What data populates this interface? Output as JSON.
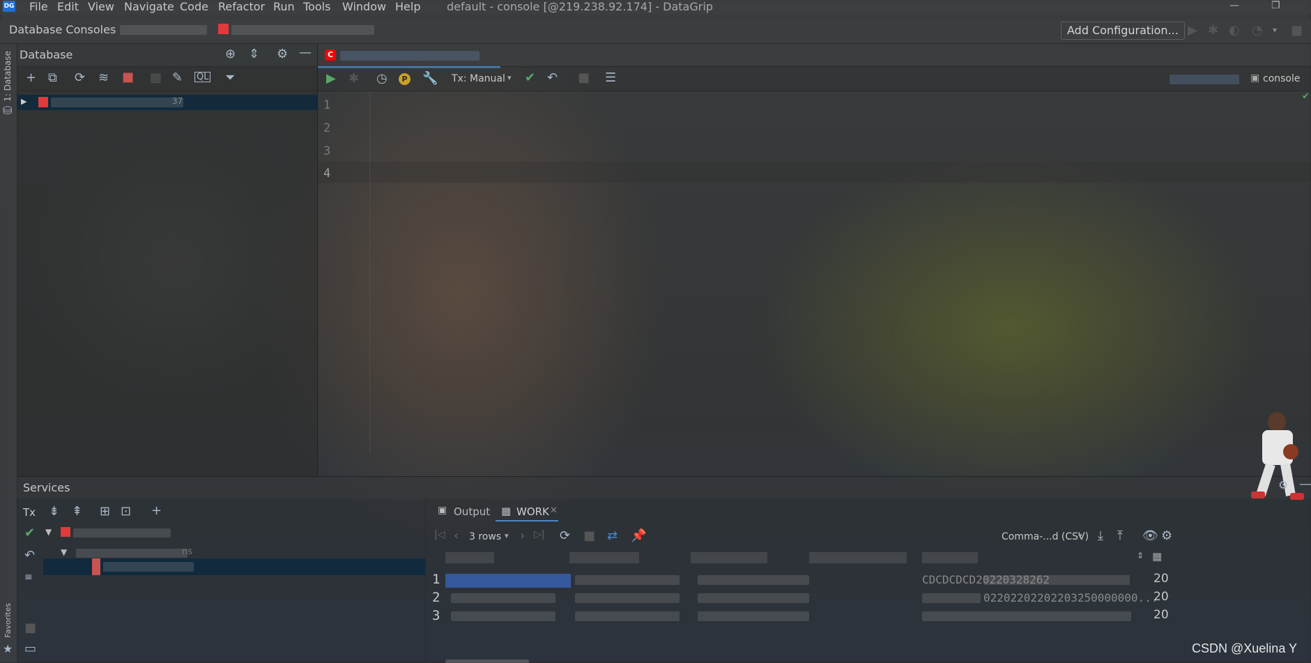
{
  "app": {
    "logo_text": "DG",
    "window_title": "default - console [@219.238.92.174] - DataGrip"
  },
  "menu": [
    "File",
    "Edit",
    "View",
    "Navigate",
    "Code",
    "Refactor",
    "Run",
    "Tools",
    "Window",
    "Help"
  ],
  "navbar": {
    "breadcrumb": "Database Consoles",
    "add_configuration": "Add Configuration..."
  },
  "left_stripe": {
    "database_label": "1: Database",
    "favorites_label": "Favorites"
  },
  "database_panel": {
    "title": "Database",
    "tree_row_suffix": "37"
  },
  "editor": {
    "tx_mode": "Tx: Manual",
    "console_label": "console",
    "line_numbers": [
      "1",
      "2",
      "3",
      "4"
    ]
  },
  "services": {
    "title": "Services",
    "tx_label": "Tx",
    "tree_child_suffix": "ns",
    "tabs": {
      "output": "Output",
      "work": "WORK"
    },
    "result": {
      "rows_label": "3 rows",
      "export_format": "Comma-...d (CSV)",
      "row_numbers": [
        "1",
        "2",
        "3"
      ],
      "partial_cell_row1": "CDCDCDCD20220328262",
      "partial_cell_row2": "02202202202203250000000...",
      "trailing_col": [
        "20",
        "20",
        "20"
      ]
    }
  },
  "watermark": "CSDN @Xuelina Y",
  "colors": {
    "selection": "#0d293e",
    "accent_blue": "#4a88c7",
    "run_green": "#59a869",
    "stop_red": "#c75450",
    "oracle_red": "#f80000"
  }
}
